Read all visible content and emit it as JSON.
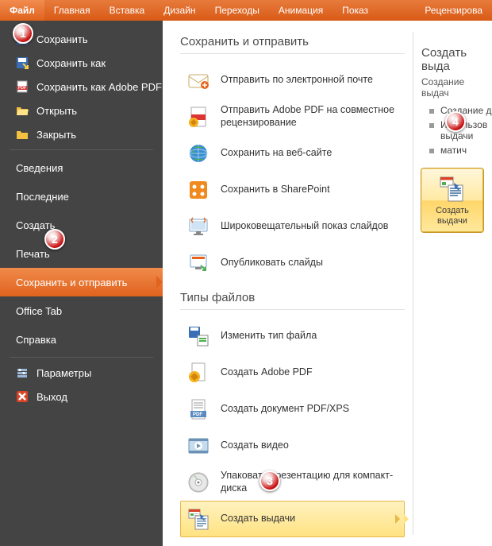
{
  "ribbon": {
    "tabs": [
      "Файл",
      "Главная",
      "Вставка",
      "Дизайн",
      "Переходы",
      "Анимация",
      "Показ слайдов",
      "Рецензирова"
    ]
  },
  "sidebar": {
    "items": [
      {
        "label": "Сохранить",
        "icon": "save"
      },
      {
        "label": "Сохранить как",
        "icon": "save-as"
      },
      {
        "label": "Сохранить как Adobe PDF",
        "icon": "pdf"
      },
      {
        "label": "Открыть",
        "icon": "open"
      },
      {
        "label": "Закрыть",
        "icon": "close-folder"
      },
      {
        "label": "Сведения",
        "noicon": true
      },
      {
        "label": "Последние",
        "noicon": true
      },
      {
        "label": "Создать",
        "noicon": true
      },
      {
        "label": "Печать",
        "noicon": true
      },
      {
        "label": "Сохранить и отправить",
        "noicon": true,
        "active": true
      },
      {
        "label": "Office Tab",
        "noicon": true
      },
      {
        "label": "Справка",
        "noicon": true
      },
      {
        "label": "Параметры",
        "icon": "options"
      },
      {
        "label": "Выход",
        "icon": "exit"
      }
    ]
  },
  "content": {
    "section1_title": "Сохранить и отправить",
    "section1_items": [
      {
        "label": "Отправить по электронной почте",
        "icon": "mail"
      },
      {
        "label": "Отправить Adobe PDF на совместное рецензирование",
        "icon": "pdf-review"
      },
      {
        "label": "Сохранить на веб-сайте",
        "icon": "web"
      },
      {
        "label": "Сохранить в SharePoint",
        "icon": "sharepoint"
      },
      {
        "label": "Широковещательный показ слайдов",
        "icon": "broadcast"
      },
      {
        "label": "Опубликовать слайды",
        "icon": "publish"
      }
    ],
    "section2_title": "Типы файлов",
    "section2_items": [
      {
        "label": "Изменить тип файла",
        "icon": "change-type"
      },
      {
        "label": "Создать Adobe PDF",
        "icon": "create-pdf"
      },
      {
        "label": "Создать документ PDF/XPS",
        "icon": "pdf-xps"
      },
      {
        "label": "Создать видео",
        "icon": "video"
      },
      {
        "label": "Упаковать презентацию для компакт-диска",
        "icon": "cd"
      },
      {
        "label": "Создать выдачи",
        "icon": "handout",
        "selected": true
      }
    ]
  },
  "right": {
    "title": "Создать выда",
    "desc": "Создание выдач",
    "bullets": [
      "Создание д",
      "Использов выдачи",
      "матич"
    ],
    "button_label": "Создать выдачи"
  },
  "callouts": {
    "1": "1",
    "2": "2",
    "3": "3",
    "4": "4"
  }
}
